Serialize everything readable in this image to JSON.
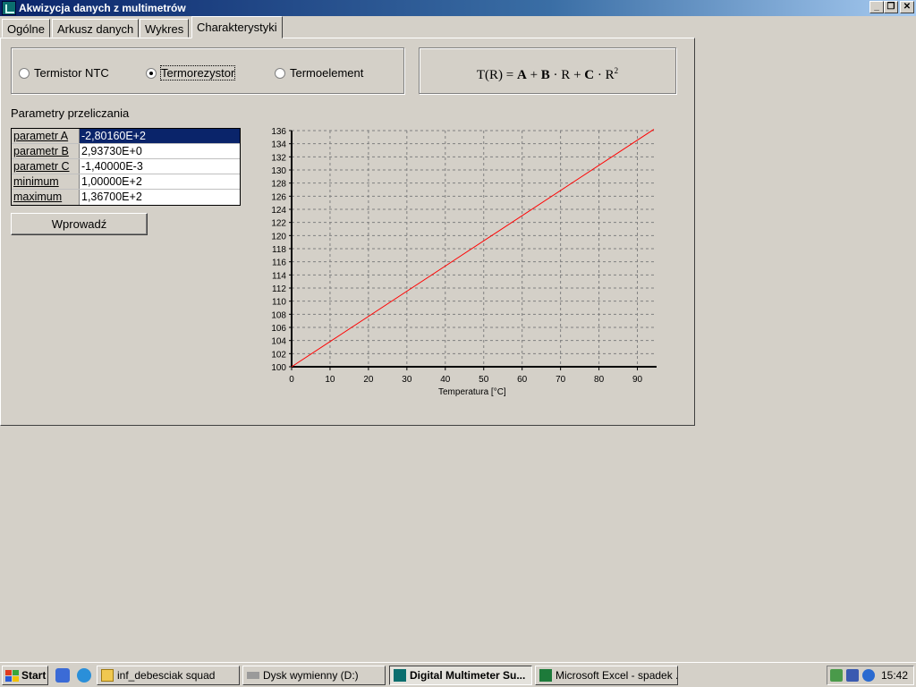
{
  "window": {
    "title": "Akwizycja danych z multimetrów"
  },
  "tabs": [
    "Ogólne",
    "Arkusz danych",
    "Wykres",
    "Charakterystyki"
  ],
  "active_tab": "Charakterystyki",
  "sensor_types": {
    "options": [
      "Termistor NTC",
      "Termorezystor",
      "Termoelement"
    ],
    "selected": "Termorezystor"
  },
  "formula": {
    "lhs": "T(R) =",
    "a": "A",
    "plus1": "+",
    "b": "B",
    "dot1": "·",
    "r1": "R",
    "plus2": "+",
    "c": "C",
    "dot2": "·",
    "r2": "R",
    "exp": "2"
  },
  "params": {
    "label": "Parametry przeliczania",
    "rows": [
      {
        "name": "parametr A",
        "value": "-2,80160E+2"
      },
      {
        "name": "parametr B",
        "value": "2,93730E+0"
      },
      {
        "name": "parametr C",
        "value": "-1,40000E-3"
      },
      {
        "name": "minimum",
        "value": "1,00000E+2"
      },
      {
        "name": "maximum",
        "value": "1,36700E+2"
      }
    ],
    "apply_label": "Wprowadź"
  },
  "chart_data": {
    "type": "line",
    "xlabel": "Temperatura [°C]",
    "ylabel": "",
    "xlim": [
      0,
      95
    ],
    "ylim": [
      100,
      136
    ],
    "x_ticks": [
      0,
      10,
      20,
      30,
      40,
      50,
      60,
      70,
      80,
      90
    ],
    "y_ticks": [
      100,
      102,
      104,
      106,
      108,
      110,
      112,
      114,
      116,
      118,
      120,
      122,
      124,
      126,
      128,
      130,
      132,
      134,
      136
    ],
    "grid": true,
    "series": [
      {
        "x": [
          0,
          94.3
        ],
        "y": [
          100,
          136.2
        ],
        "color": "#ff0000"
      }
    ]
  },
  "taskbar": {
    "start_label": "Start",
    "tasks": [
      {
        "label": "inf_debesciak squad",
        "icon": "folder-icon"
      },
      {
        "label": "Dysk wymienny (D:)",
        "icon": "drive-icon"
      },
      {
        "label": "Digital Multimeter Su...",
        "icon": "app-icon",
        "active": true
      },
      {
        "label": "Microsoft Excel - spadek ...",
        "icon": "excel-icon"
      }
    ],
    "clock": "15:42"
  },
  "colors": {
    "titlebar": "#0a246a",
    "selection": "#0a246a",
    "series": "#ff0000"
  }
}
